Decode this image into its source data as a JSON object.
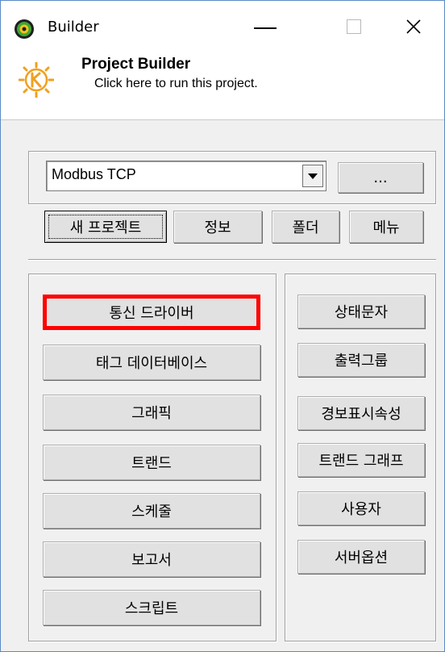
{
  "window": {
    "title": "Builder",
    "close_glyph": "✕",
    "icons": {
      "app": "green-gear-icon",
      "logo": "k-sun-logo-icon"
    }
  },
  "header": {
    "title": "Project Builder",
    "subtitle": "Click here to run this project."
  },
  "project_select": {
    "value": "Modbus TCP",
    "browse_label": "..."
  },
  "top_buttons": {
    "new_project": "새 프로젝트",
    "info": "정보",
    "folder": "폴더",
    "menu": "메뉴"
  },
  "left_buttons": [
    "통신 드라이버",
    "태그 데이터베이스",
    "그래픽",
    "트랜드",
    "스케줄",
    "보고서",
    "스크립트"
  ],
  "right_buttons": [
    "상태문자",
    "출력그룹",
    "경보표시속성",
    "트랜드 그래프",
    "사용자",
    "서버옵션"
  ],
  "colors": {
    "highlight": "#ff0000",
    "button_face": "#e1e1e1",
    "window_bg": "#f0f0f0"
  }
}
